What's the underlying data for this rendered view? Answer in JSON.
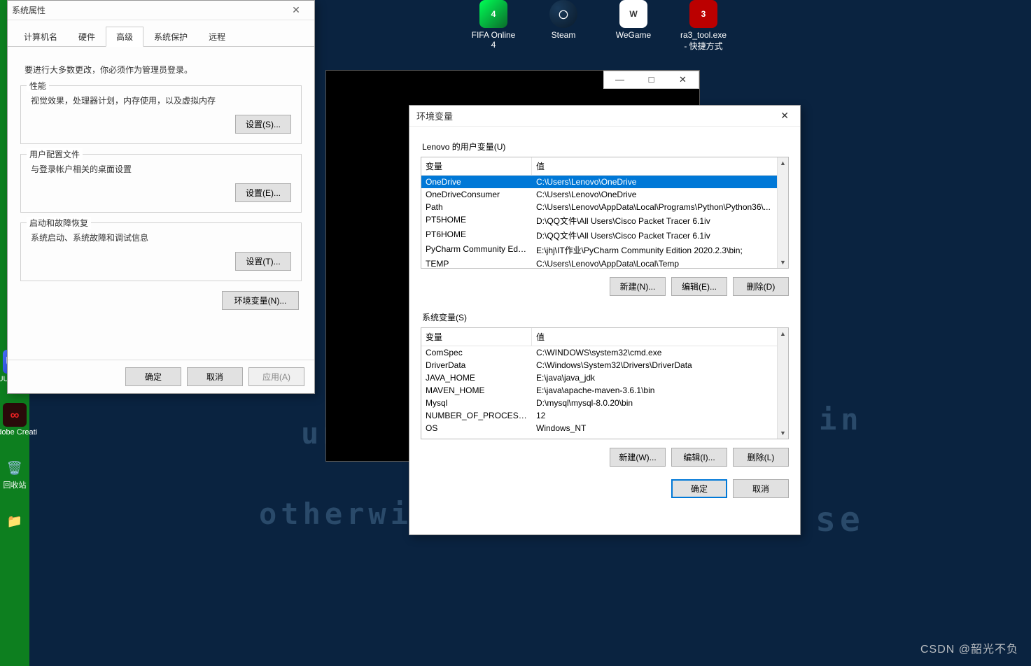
{
  "desktop": {
    "top_icons": [
      {
        "label": "FIFA Online 4"
      },
      {
        "label": "Steam"
      },
      {
        "label": "WeGame"
      },
      {
        "label": "ra3_tool.exe - 快捷方式"
      }
    ],
    "left_icons": {
      "uu": "UU加速器",
      "adobe": "Adobe Creati",
      "bin": "回收站",
      "folder": "文件夹"
    },
    "wall1": "unLes",
    "wall2": "otherwis",
    "wall3": "in",
    "wall4": "se"
  },
  "sysprop": {
    "title": "系统属性",
    "tabs": {
      "t1": "计算机名",
      "t2": "硬件",
      "t3": "高级",
      "t4": "系统保护",
      "t5": "远程"
    },
    "notice": "要进行大多数更改，你必须作为管理员登录。",
    "perf": {
      "legend": "性能",
      "desc": "视觉效果，处理器计划，内存使用，以及虚拟内存",
      "btn": "设置(S)..."
    },
    "profile": {
      "legend": "用户配置文件",
      "desc": "与登录帐户相关的桌面设置",
      "btn": "设置(E)..."
    },
    "startup": {
      "legend": "启动和故障恢复",
      "desc": "系统启动、系统故障和调试信息",
      "btn": "设置(T)..."
    },
    "envbtn": "环境变量(N)...",
    "ok": "确定",
    "cancel": "取消",
    "apply": "应用(A)"
  },
  "env": {
    "title": "环境变量",
    "user_section": "Lenovo 的用户变量(U)",
    "sys_section": "系统变量(S)",
    "col_var": "变量",
    "col_val": "值",
    "user_rows": [
      {
        "var": "OneDrive",
        "val": "C:\\Users\\Lenovo\\OneDrive"
      },
      {
        "var": "OneDriveConsumer",
        "val": "C:\\Users\\Lenovo\\OneDrive"
      },
      {
        "var": "Path",
        "val": "C:\\Users\\Lenovo\\AppData\\Local\\Programs\\Python\\Python36\\..."
      },
      {
        "var": "PT5HOME",
        "val": "D:\\QQ文件\\All Users\\Cisco Packet Tracer 6.1iv"
      },
      {
        "var": "PT6HOME",
        "val": "D:\\QQ文件\\All Users\\Cisco Packet Tracer 6.1iv"
      },
      {
        "var": "PyCharm Community Editi...",
        "val": "E:\\jhj\\IT作业\\PyCharm Community Edition 2020.2.3\\bin;"
      },
      {
        "var": "TEMP",
        "val": "C:\\Users\\Lenovo\\AppData\\Local\\Temp"
      }
    ],
    "sys_rows": [
      {
        "var": "ComSpec",
        "val": "C:\\WINDOWS\\system32\\cmd.exe"
      },
      {
        "var": "DriverData",
        "val": "C:\\Windows\\System32\\Drivers\\DriverData"
      },
      {
        "var": "JAVA_HOME",
        "val": "E:\\java\\java_jdk"
      },
      {
        "var": "MAVEN_HOME",
        "val": "E:\\java\\apache-maven-3.6.1\\bin"
      },
      {
        "var": "Mysql",
        "val": "D:\\mysql\\mysql-8.0.20\\bin"
      },
      {
        "var": "NUMBER_OF_PROCESSORS",
        "val": "12"
      },
      {
        "var": "OS",
        "val": "Windows_NT"
      }
    ],
    "new_u": "新建(N)...",
    "edit_u": "编辑(E)...",
    "del_u": "删除(D)",
    "new_s": "新建(W)...",
    "edit_s": "编辑(I)...",
    "del_s": "删除(L)",
    "ok": "确定",
    "cancel": "取消"
  },
  "watermark": "CSDN @韶光不负"
}
